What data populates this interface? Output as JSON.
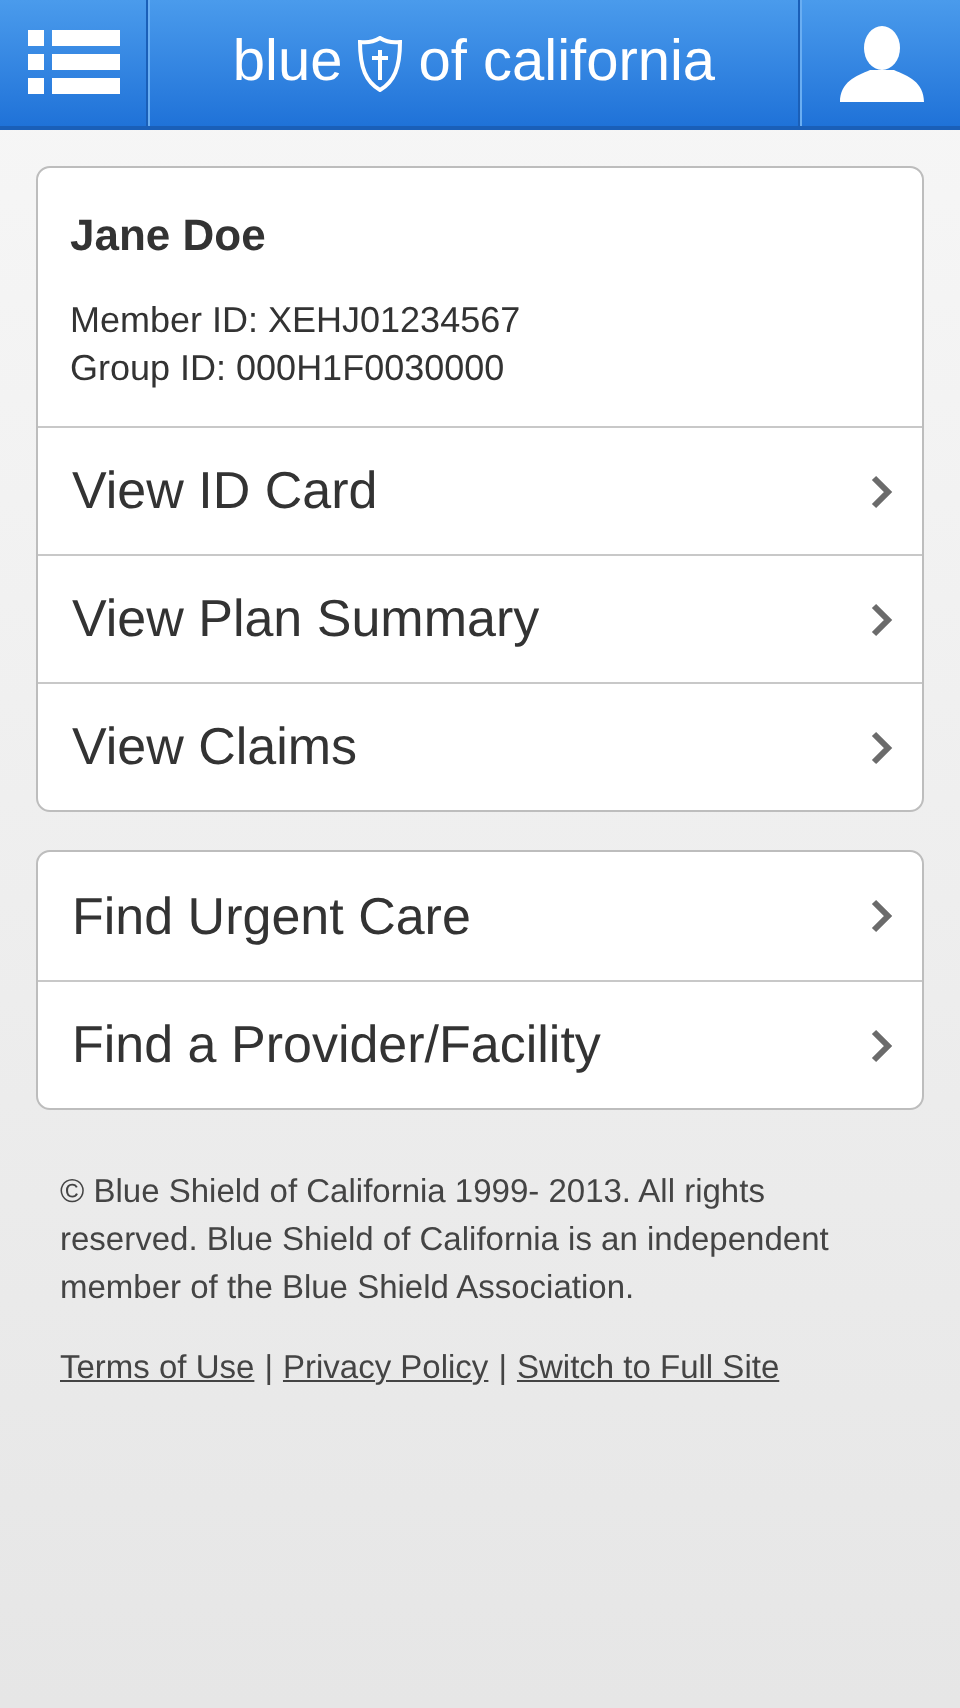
{
  "header": {
    "logo_left": "blue",
    "logo_right": "of california"
  },
  "member": {
    "name": "Jane Doe",
    "member_id": "Member ID: XEHJ01234567",
    "group_id": "Group ID: 000H1F0030000"
  },
  "member_links": [
    {
      "label": "View ID Card"
    },
    {
      "label": "View Plan Summary"
    },
    {
      "label": "View Claims"
    }
  ],
  "find_links": [
    {
      "label": "Find Urgent Care"
    },
    {
      "label": "Find a Provider/Facility"
    }
  ],
  "footer": {
    "copyright": "© Blue Shield of California 1999- 2013. All rights reserved. Blue Shield of California is an independent member of the Blue Shield Association.",
    "links": [
      {
        "label": "Terms of Use"
      },
      {
        "label": "Privacy Policy"
      },
      {
        "label": "Switch to Full Site"
      }
    ],
    "separator": "|"
  }
}
